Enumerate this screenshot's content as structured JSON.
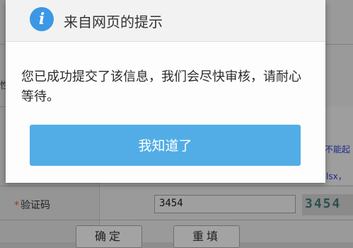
{
  "dialog": {
    "icon": "info-icon",
    "icon_glyph": "i",
    "title": "来自网页的提示",
    "message": "您已成功提交了该信息，我们会尽快审核，请耐心等待。",
    "ok_label": "我知道了"
  },
  "form": {
    "partial_label_left": "性",
    "partial_link_right_1": "不能起",
    "partial_link_right_2": "lsx，",
    "captcha_label": "验证码",
    "captcha_required_mark": "*",
    "captcha_value": "3454",
    "captcha_image_text": "3454",
    "confirm_label": "确定",
    "reset_label": "重填"
  },
  "colors": {
    "dialog_icon": "#3c97e5",
    "ok_button": "#52ade6",
    "required_mark": "#a83222"
  }
}
